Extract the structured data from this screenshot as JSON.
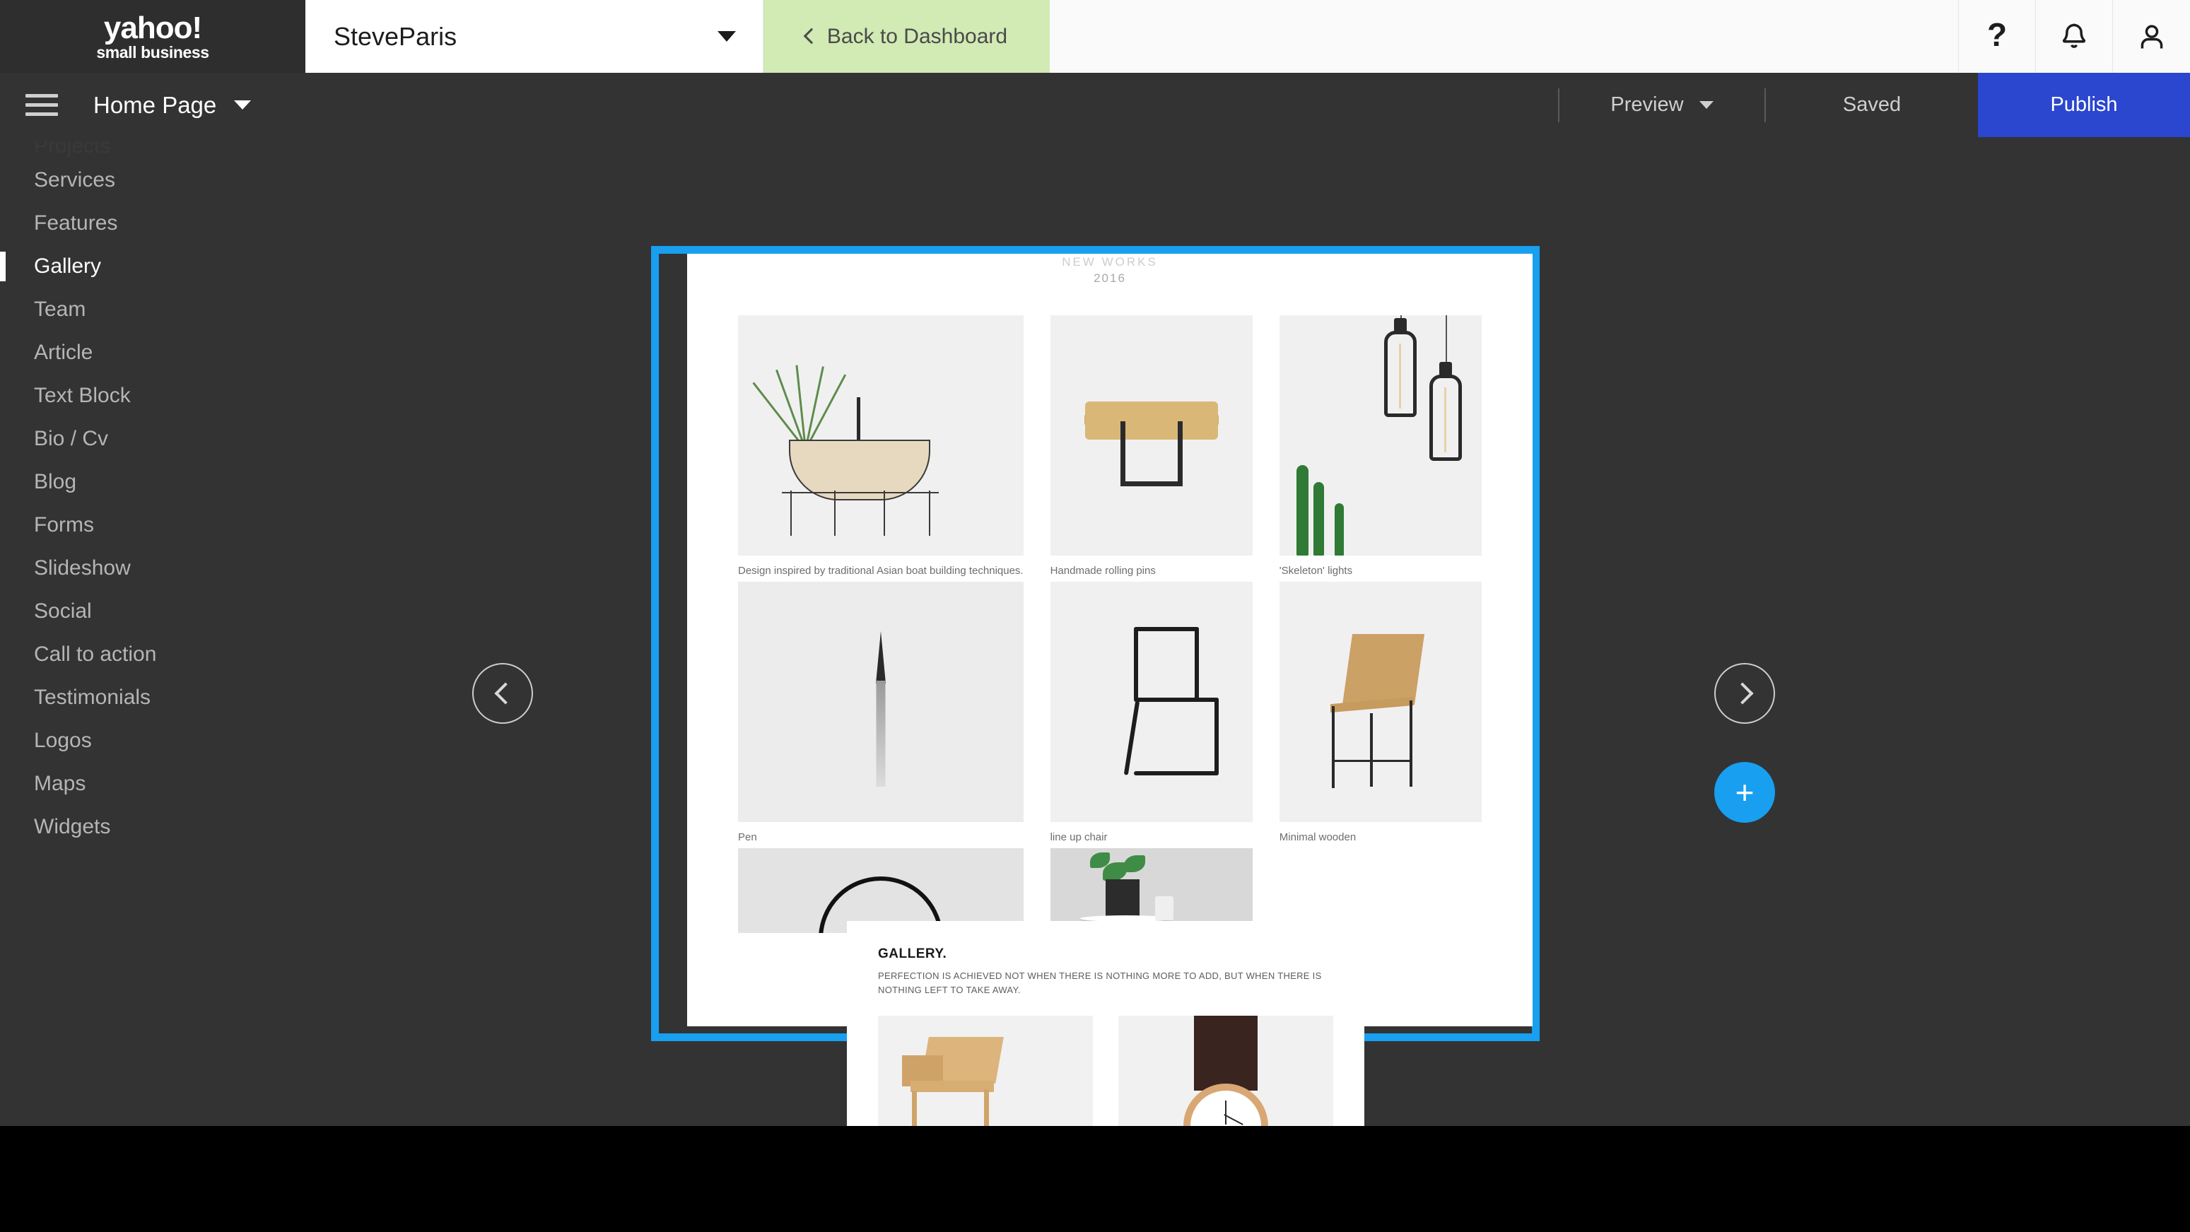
{
  "topbar": {
    "logo_line1": "yahoo!",
    "logo_line2": "small business",
    "site_name": "SteveParis",
    "site_select_icon": "chevron-down-icon",
    "back_to_dashboard": "Back to Dashboard",
    "back_icon": "chevron-left-icon",
    "help_icon": "?",
    "bell_icon": "notification-bell-icon",
    "account_icon": "user-account-icon"
  },
  "toolbar": {
    "menu_icon": "hamburger-menu-icon",
    "page_name": "Home Page",
    "page_caret": "chevron-down-icon",
    "preview_label": "Preview",
    "preview_caret": "chevron-down-icon",
    "saved_label": "Saved",
    "publish_label": "Publish",
    "publish_color": "#2b46cf"
  },
  "sidebar": {
    "partial_top_item": "Projects",
    "items": [
      {
        "label": "Services",
        "active": false
      },
      {
        "label": "Features",
        "active": false
      },
      {
        "label": "Gallery",
        "active": true
      },
      {
        "label": "Team",
        "active": false
      },
      {
        "label": "Article",
        "active": false
      },
      {
        "label": "Text Block",
        "active": false
      },
      {
        "label": "Bio / Cv",
        "active": false
      },
      {
        "label": "Blog",
        "active": false
      },
      {
        "label": "Forms",
        "active": false
      },
      {
        "label": "Slideshow",
        "active": false
      },
      {
        "label": "Social",
        "active": false
      },
      {
        "label": "Call to action",
        "active": false
      },
      {
        "label": "Testimonials",
        "active": false
      },
      {
        "label": "Logos",
        "active": false
      },
      {
        "label": "Maps",
        "active": false
      },
      {
        "label": "Widgets",
        "active": false
      }
    ]
  },
  "canvas": {
    "prev_icon": "chevron-left-icon",
    "next_icon": "chevron-right-icon",
    "add_icon": "plus-icon",
    "selection_color": "#189ff0",
    "add_button_color": "#189ff0"
  },
  "selected_section": {
    "heading_cut": "NEW WORKS",
    "year": "2016",
    "tiles": [
      {
        "caption": "Design inspired by traditional Asian boat building techniques."
      },
      {
        "caption": "Handmade rolling pins"
      },
      {
        "caption": "'Skeleton' lights"
      },
      {
        "caption": "Pen"
      },
      {
        "caption": "line up chair"
      },
      {
        "caption": "Minimal wooden"
      },
      {
        "caption": ""
      },
      {
        "caption": ""
      },
      {
        "caption": ""
      }
    ]
  },
  "second_section": {
    "title": "GALLERY.",
    "subtitle": "PERFECTION IS ACHIEVED NOT WHEN THERE IS NOTHING MORE TO ADD, BUT WHEN THERE IS NOTHING LEFT TO TAKE AWAY.",
    "tiles": [
      {
        "caption": ""
      },
      {
        "caption": ""
      }
    ]
  }
}
